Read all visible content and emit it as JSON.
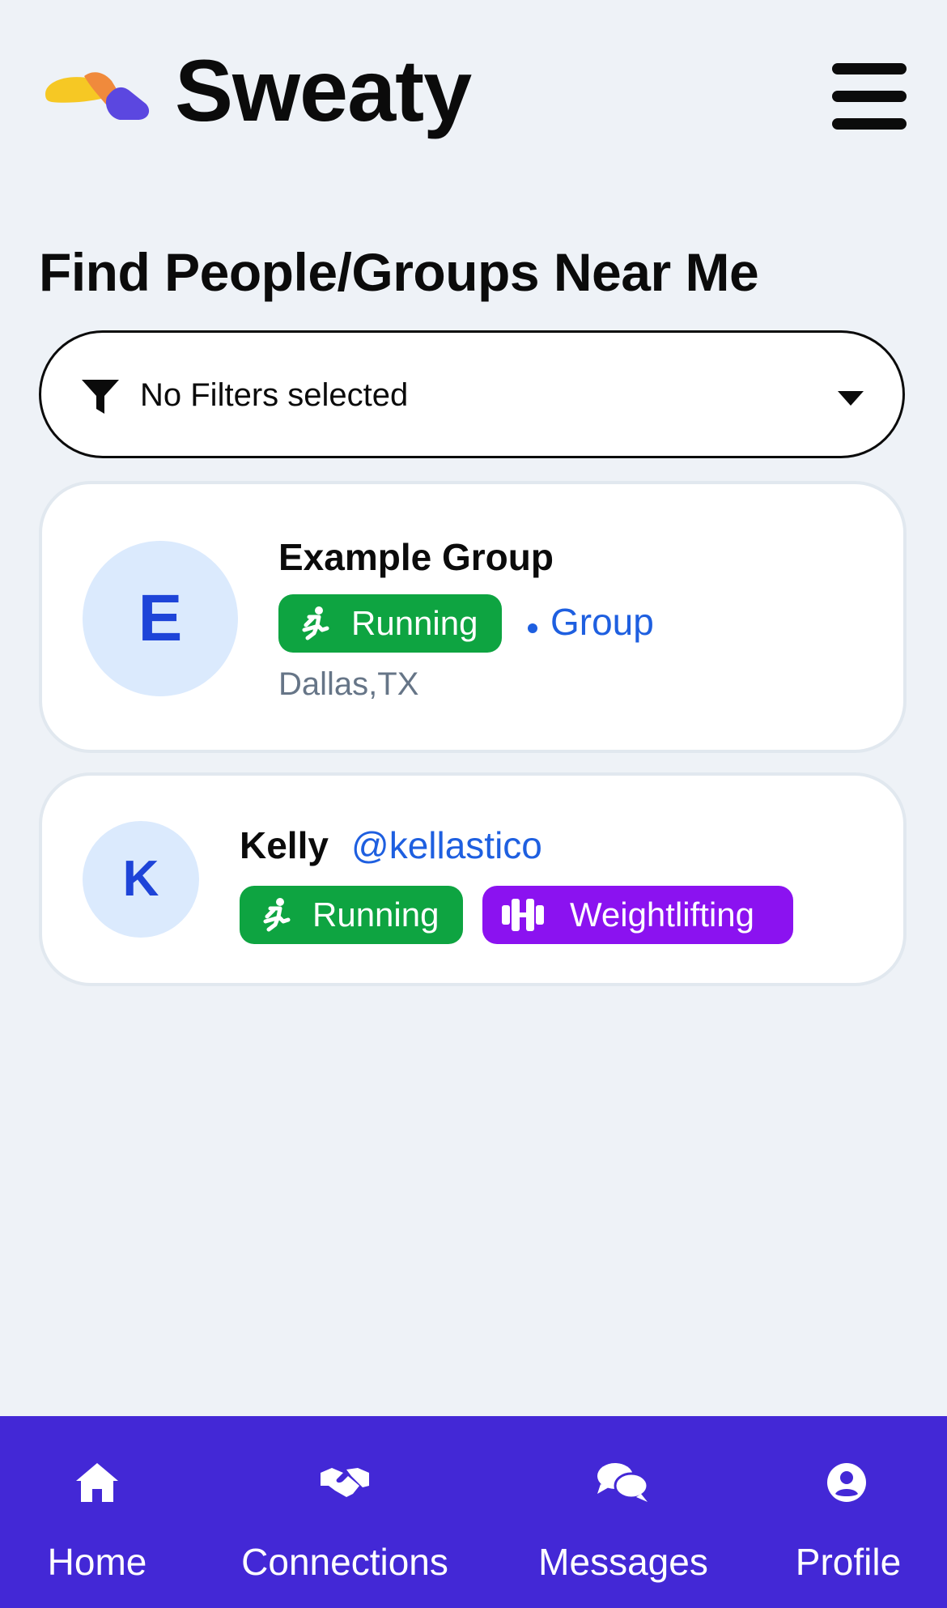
{
  "app": {
    "title": "Sweaty",
    "logo_icon": "sweaty-logo-icon",
    "menu_icon": "hamburger-menu-icon"
  },
  "page": {
    "title": "Find People/Groups Near Me"
  },
  "filter": {
    "label": "No Filters selected",
    "icon": "funnel-icon",
    "dropdown_icon": "caret-down-icon"
  },
  "results": [
    {
      "avatar_letter": "E",
      "name": "Example Group",
      "tags": [
        {
          "label": "Running",
          "icon": "running-icon",
          "color": "#0ea441"
        }
      ],
      "type": "Group",
      "location": "Dallas,TX"
    },
    {
      "avatar_letter": "K",
      "name": "Kelly",
      "handle": "@kellastico",
      "tags": [
        {
          "label": "Running",
          "icon": "running-icon",
          "color": "#0ea441"
        },
        {
          "label": "Weightlifting",
          "icon": "dumbbell-icon",
          "color": "#8b12f0"
        }
      ]
    }
  ],
  "tabbar": {
    "background": "#4328d6",
    "items": [
      {
        "label": "Home",
        "icon": "home-icon"
      },
      {
        "label": "Connections",
        "icon": "handshake-icon"
      },
      {
        "label": "Messages",
        "icon": "chat-bubbles-icon"
      },
      {
        "label": "Profile",
        "icon": "user-circle-icon"
      }
    ]
  }
}
